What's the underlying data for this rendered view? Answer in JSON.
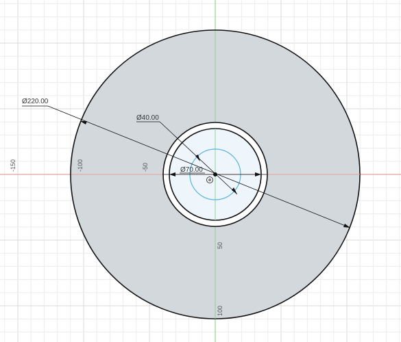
{
  "canvas": {
    "background": "#ffffff",
    "grid_minor_color": "#ececec",
    "grid_major_color": "#d9d9d9",
    "x_axis_color": "#e28a8a",
    "y_axis_color": "#7fcf7f"
  },
  "sketch": {
    "outer_fill": "#d3d8dd",
    "outer_stroke": "#111111",
    "inner_fill": "#eef6fc",
    "construction_circle_color": "#5ab4dc",
    "dimension_line_color": "#111111"
  },
  "dimensions": {
    "outer_diameter": "Ø220.00",
    "hole_diameter": "Ø40.00",
    "ring_diameter": "Ø70.00"
  },
  "ruler_labels": {
    "x_minus_150": "-150",
    "x_minus_100": "-100",
    "x_minus_50": "-50",
    "y_50": "50",
    "y_100": "100"
  }
}
